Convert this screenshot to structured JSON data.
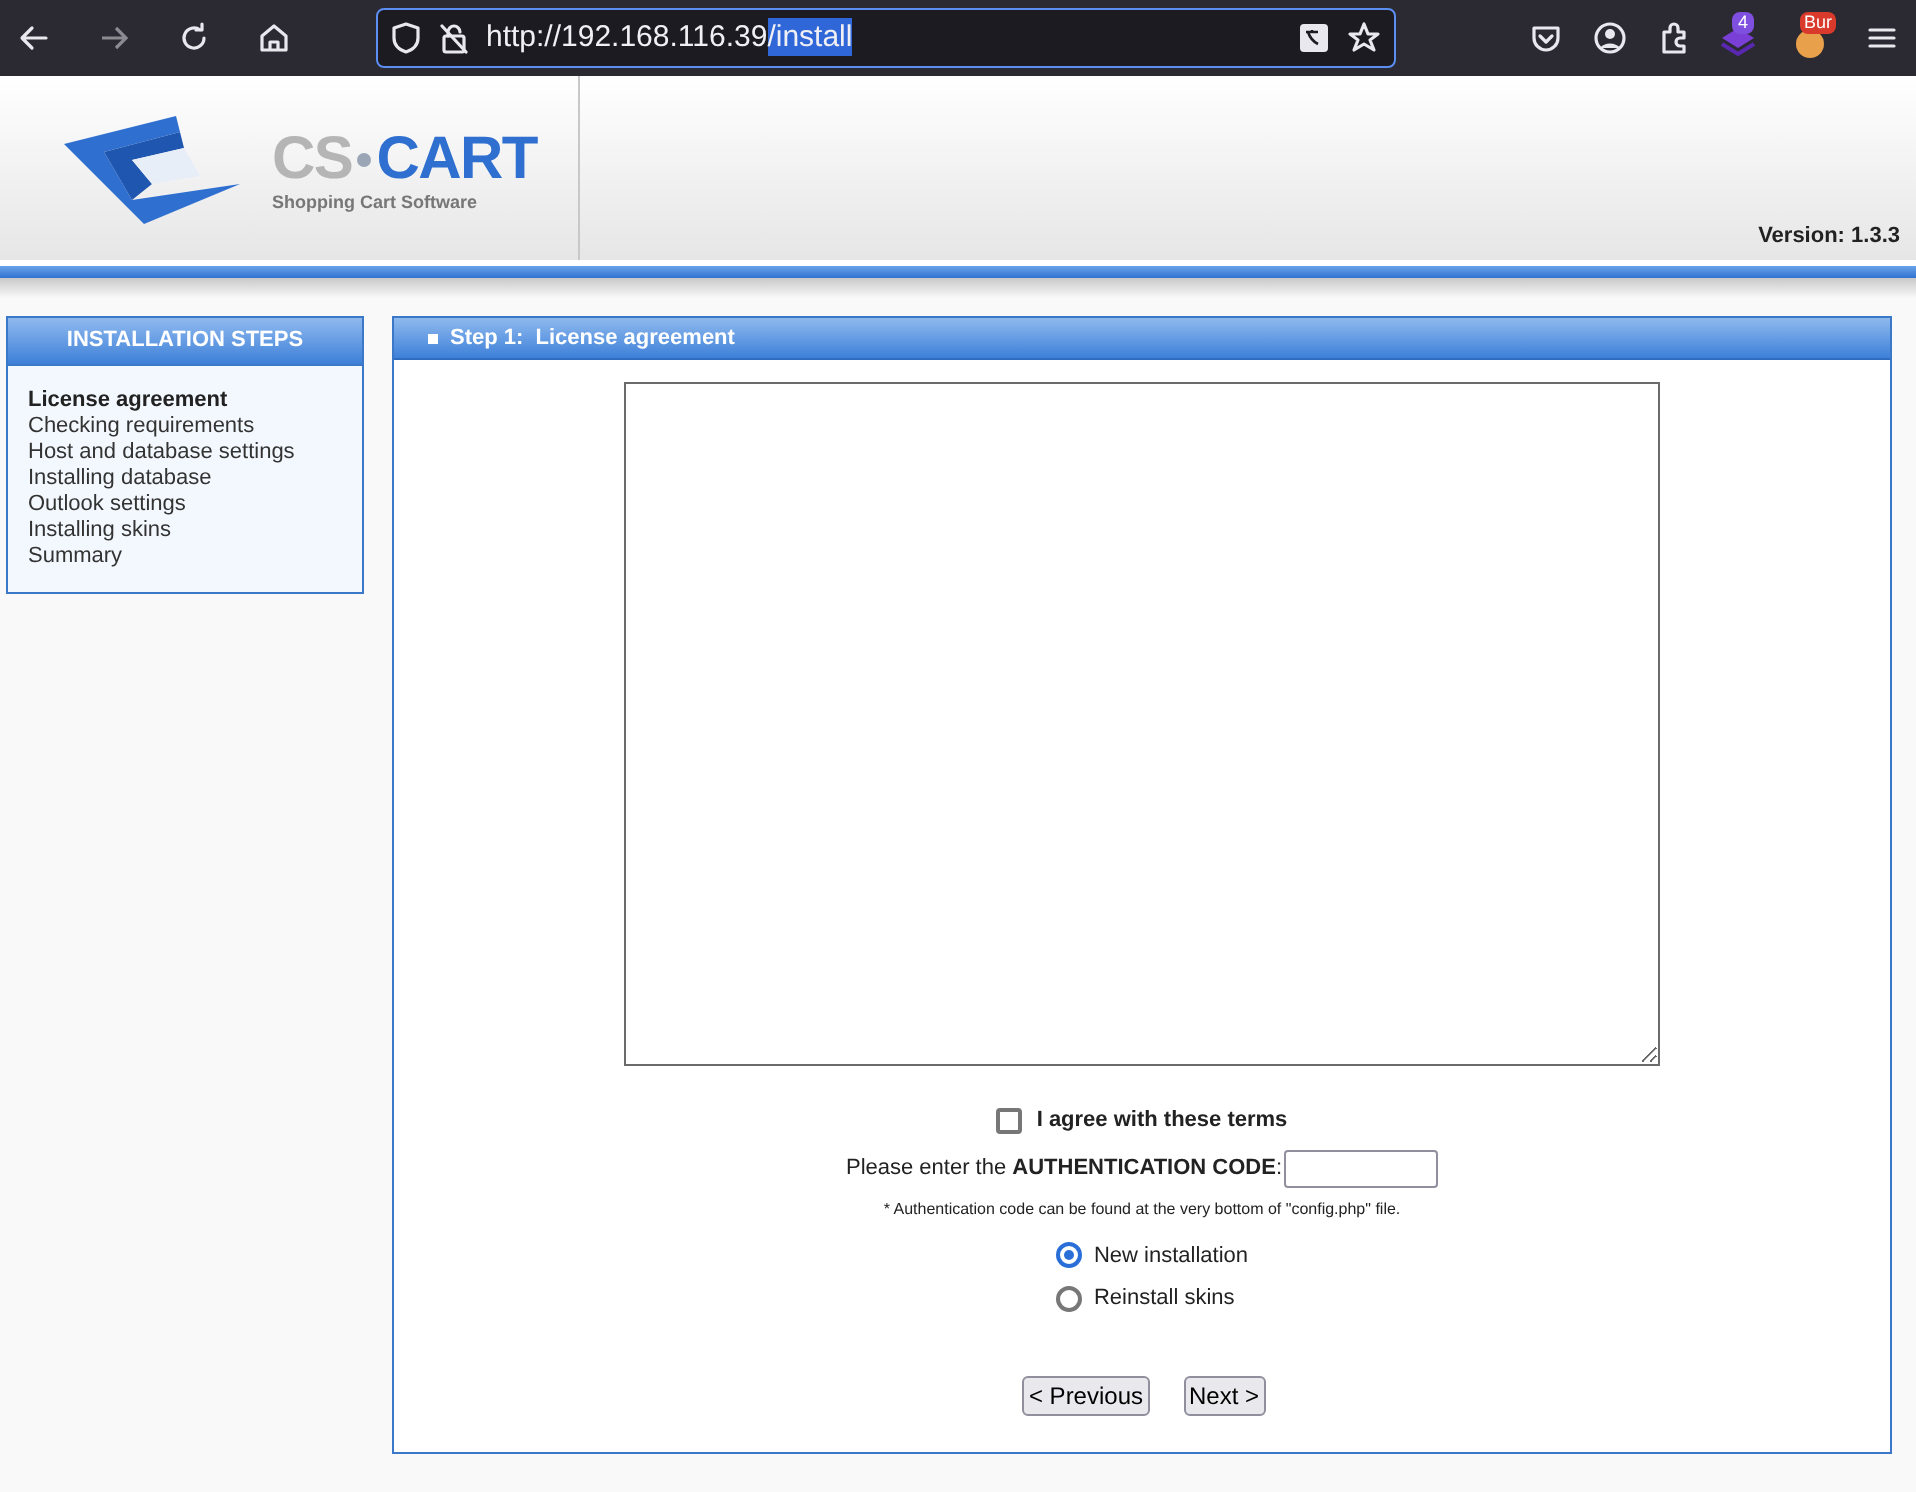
{
  "browser": {
    "url_host": "http://192.168.116.39",
    "url_path": "/install",
    "extension_badges": [
      {
        "kind": "count",
        "text": "4"
      },
      {
        "kind": "label",
        "text": "Bur"
      }
    ]
  },
  "header": {
    "logo": {
      "left": "CS",
      "right": "CART",
      "tagline": "Shopping Cart Software"
    },
    "version": "Version: 1.3.3"
  },
  "sidebar": {
    "title": "INSTALLATION STEPS",
    "items": [
      {
        "label": "License agreement",
        "selected": true
      },
      {
        "label": "Checking requirements",
        "selected": false
      },
      {
        "label": "Host and database settings",
        "selected": false
      },
      {
        "label": "Installing database",
        "selected": false
      },
      {
        "label": "Outlook settings",
        "selected": false
      },
      {
        "label": "Installing skins",
        "selected": false
      },
      {
        "label": "Summary",
        "selected": false
      }
    ]
  },
  "panel": {
    "title": "Step 1:  License agreement",
    "agree": {
      "label": "I agree with these terms",
      "checked": false
    },
    "auth_label": "Please enter the **AUTHENTICATION CODE**:",
    "auth_note": "* Authentication code can be found at the very bottom of \"config.php\" file.",
    "options": [
      {
        "label": "New installation",
        "selected": true
      },
      {
        "label": "Reinstall skins",
        "selected": false
      }
    ],
    "buttons": [
      "< Previous",
      "Next >"
    ]
  }
}
